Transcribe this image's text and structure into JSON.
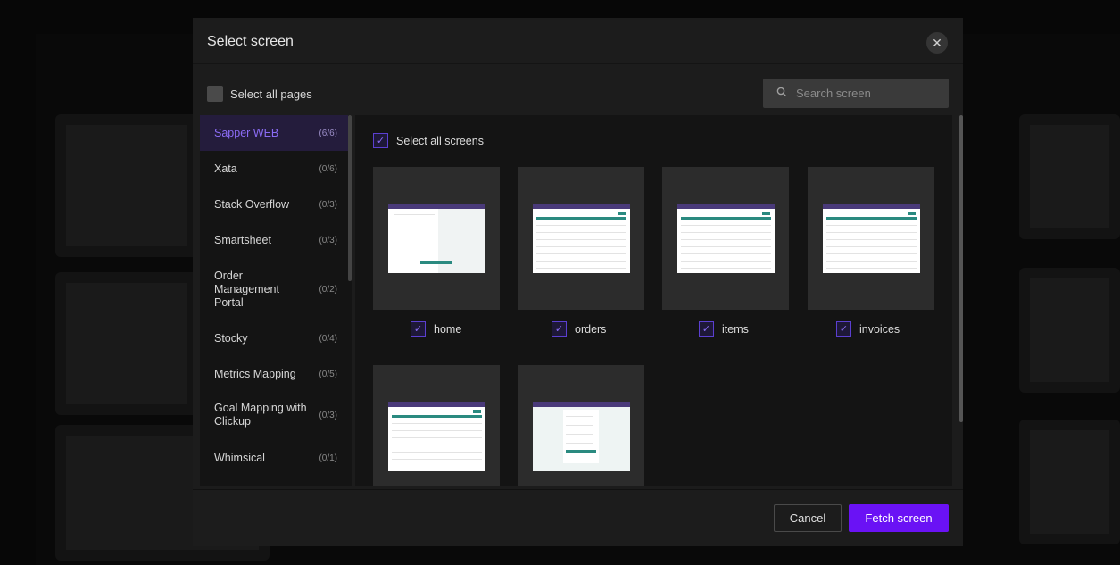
{
  "modal": {
    "title": "Select screen",
    "close_icon": "close-icon",
    "select_all_pages_label": "Select all pages",
    "search_placeholder": "Search screen",
    "select_all_screens_label": "Select all screens",
    "cancel_label": "Cancel",
    "fetch_label": "Fetch screen",
    "accent_color": "#6a12f5"
  },
  "pages": [
    {
      "name": "Sapper WEB",
      "count": "(6/6)",
      "active": true
    },
    {
      "name": "Xata",
      "count": "(0/6)"
    },
    {
      "name": "Stack Overflow",
      "count": "(0/3)"
    },
    {
      "name": "Smartsheet",
      "count": "(0/3)"
    },
    {
      "name": "Order Management Portal",
      "count": "(0/2)"
    },
    {
      "name": "Stocky",
      "count": "(0/4)"
    },
    {
      "name": "Metrics Mapping",
      "count": "(0/5)"
    },
    {
      "name": "Goal Mapping with Clickup",
      "count": "(0/3)"
    },
    {
      "name": "Whimsical",
      "count": "(0/1)"
    }
  ],
  "screens": [
    {
      "name": "home",
      "checked": true
    },
    {
      "name": "orders",
      "checked": true
    },
    {
      "name": "items",
      "checked": true
    },
    {
      "name": "invoices",
      "checked": true
    },
    {
      "name": "",
      "checked": true
    },
    {
      "name": "",
      "checked": true
    }
  ]
}
